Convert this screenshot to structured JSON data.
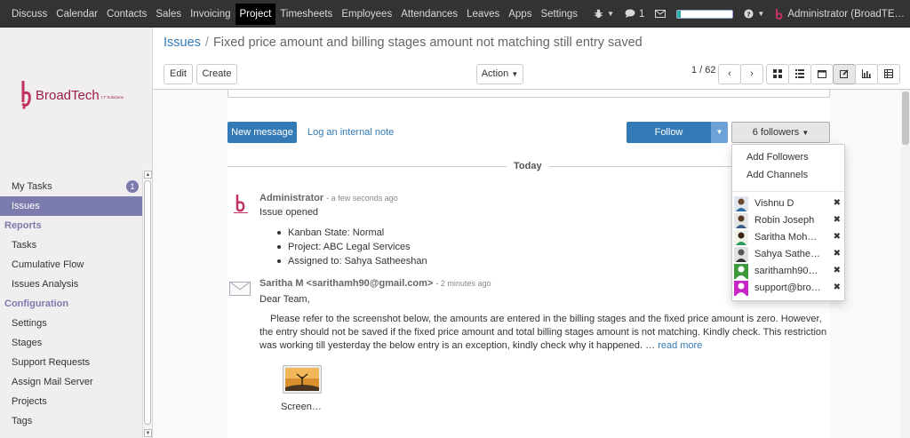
{
  "topbar": {
    "menu": [
      "Discuss",
      "Calendar",
      "Contacts",
      "Sales",
      "Invoicing",
      "Project",
      "Timesheets",
      "Employees",
      "Attendances",
      "Leaves",
      "Apps",
      "Settings"
    ],
    "active": "Project",
    "message_count": "1",
    "progress_fraction": 0.05,
    "user": "Administrator (BroadTE…"
  },
  "logo": {
    "brand": "BroadTech",
    "tagline": "I.T Solutions",
    "brand_color": "#9a1d4a"
  },
  "sidebar": {
    "my_tasks": "My Tasks",
    "my_tasks_badge": "1",
    "issues": "Issues",
    "reports_head": "Reports",
    "reports": [
      "Tasks",
      "Cumulative Flow",
      "Issues Analysis"
    ],
    "config_head": "Configuration",
    "config": [
      "Settings",
      "Stages",
      "Support Requests",
      "Assign Mail Server",
      "Projects",
      "Tags"
    ]
  },
  "breadcrumb": {
    "parent": "Issues",
    "separator": "/",
    "current": "Fixed price amount and billing stages amount not matching still entry saved"
  },
  "toolbar": {
    "edit": "Edit",
    "create": "Create",
    "action": "Action",
    "pager": "1 / 62"
  },
  "chatter": {
    "new_message": "New message",
    "log_note": "Log an internal note",
    "follow": "Follow",
    "followers_btn": "6 followers",
    "today": "Today"
  },
  "message1": {
    "author": "Administrator",
    "date": "- a few seconds ago",
    "body": "Issue opened",
    "tracking": [
      "Kanban State: Normal",
      "Project: ABC Legal Services",
      "Assigned to: Sahya Satheeshan"
    ]
  },
  "message2": {
    "author": "Saritha M <sarithamh90@gmail.com>",
    "date": "- 2 minutes ago",
    "greeting": "Dear Team,",
    "body": "Please refer to the screenshot below, the amounts are entered in the billing stages and the fixed price amount is zero. However, the entry should not be saved if the fixed price amount and total billing stages amount is not matching. Kindly check. This restriction was working till yesterday the below entry is an exception, kindly check why it happened. …",
    "read_more": "read more",
    "attachment": "Screen…"
  },
  "followers_dropdown": {
    "add_followers": "Add Followers",
    "add_channels": "Add Channels",
    "users": [
      "Vishnu D",
      "Robin Joseph",
      "Saritha Moha…",
      "Sahya Sathee…",
      "sarithamh90…",
      "support@broa…"
    ]
  },
  "colors": {
    "primary": "#337ab7",
    "sidebar_active": "#7c7bad",
    "topbar": "#333333"
  }
}
